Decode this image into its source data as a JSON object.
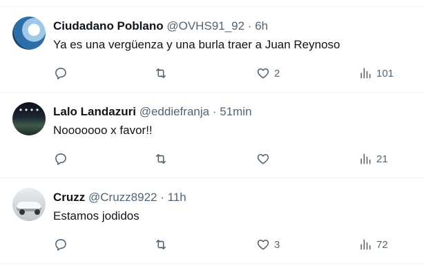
{
  "tweets": [
    {
      "name": "Ciudadano Poblano",
      "handle": "@OVHS91_92",
      "separator": "·",
      "time": "6h",
      "text": "Ya es una vergüenza y una burla traer a Juan Reynoso",
      "replies": "",
      "retweets": "",
      "likes": "2",
      "views": "101"
    },
    {
      "name": "Lalo Landazuri",
      "handle": "@eddiefranja",
      "separator": "·",
      "time": "51min",
      "text": "Nooooooo x favor!!",
      "replies": "",
      "retweets": "",
      "likes": "",
      "views": "21"
    },
    {
      "name": "Cruzz",
      "handle": "@Cruzz8922",
      "separator": "·",
      "time": "11h",
      "text": "Estamos jodidos",
      "replies": "",
      "retweets": "",
      "likes": "3",
      "views": "72"
    }
  ],
  "icons": {
    "reply": "reply-icon",
    "retweet": "retweet-icon",
    "like": "heart-icon",
    "views": "views-icon"
  },
  "colors": {
    "text": "#0f1419",
    "secondary": "#536471",
    "divider": "#eff3f4"
  }
}
